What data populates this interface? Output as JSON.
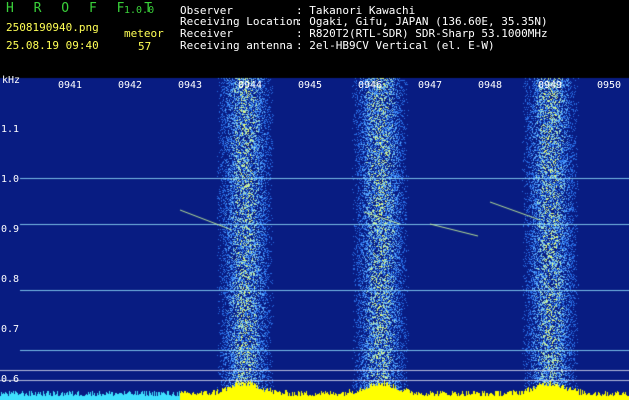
{
  "app": {
    "title": "H R O F F T",
    "version": "1.0.0"
  },
  "capture": {
    "filename": "2508190940.png",
    "datetime": "25.08.19 09:40",
    "meteor_label": "meteor",
    "meteor_count": "57"
  },
  "info": {
    "rows": [
      {
        "label": "Observer",
        "value": ": Takanori Kawachi"
      },
      {
        "label": "Receiving Location",
        "value": ": Ogaki, Gifu, JAPAN (136.60E, 35.35N)"
      },
      {
        "label": "Receiver",
        "value": ": R820T2(RTL-SDR) SDR-Sharp 53.1000MHz"
      },
      {
        "label": "Receiving antenna",
        "value": ": 2el-HB9CV Vertical (el. E-W)"
      }
    ]
  },
  "spectrogram": {
    "freq_unit": "kHz",
    "time_ticks": [
      "0941",
      "0942",
      "0943",
      "0944",
      "0945",
      "0946",
      "0947",
      "0948",
      "0949",
      "0950"
    ],
    "freq_ticks": [
      "1.1",
      "1.0",
      "0.9",
      "0.8",
      "0.7",
      "0.6"
    ],
    "colors": {
      "background": "#0a1f8f",
      "signal": "#4fa0ff",
      "hot": "#e8ff60",
      "baseline": "#ffff00",
      "carrier": "#8ee6ff"
    }
  }
}
